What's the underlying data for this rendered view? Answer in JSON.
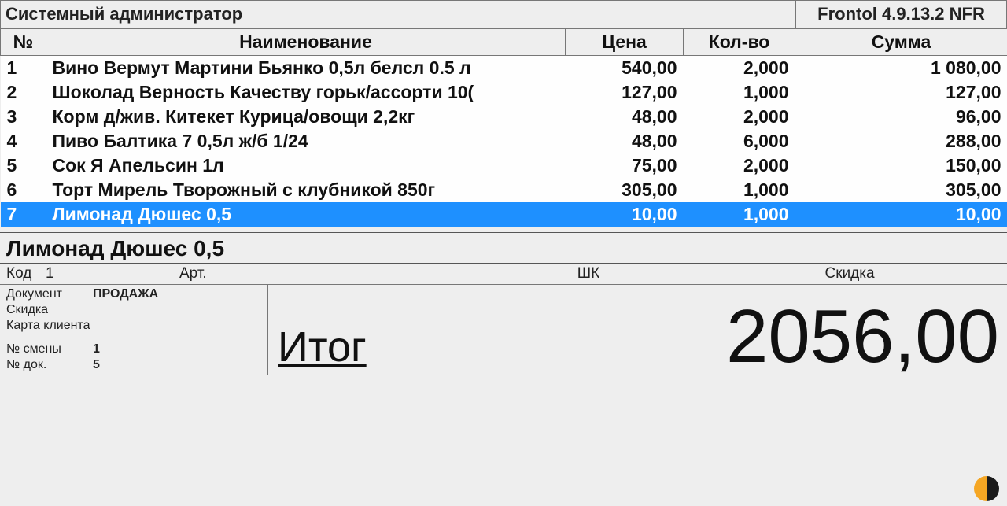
{
  "header": {
    "user_role": "Системный администратор",
    "app_version": "Frontol 4.9.13.2 NFR"
  },
  "table": {
    "columns": {
      "num": "№",
      "name": "Наименование",
      "price": "Цена",
      "qty": "Кол-во",
      "sum": "Сумма"
    },
    "rows": [
      {
        "num": "1",
        "name": "Вино Вермут Мартини Бьянко 0,5л белсл 0.5 л",
        "price": "540,00",
        "qty": "2,000",
        "sum": "1 080,00",
        "selected": false
      },
      {
        "num": "2",
        "name": "Шоколад Верность Качеству горьк/ассорти 10(",
        "price": "127,00",
        "qty": "1,000",
        "sum": "127,00",
        "selected": false
      },
      {
        "num": "3",
        "name": "Корм д/жив. Китекет Курица/овощи 2,2кг",
        "price": "48,00",
        "qty": "2,000",
        "sum": "96,00",
        "selected": false
      },
      {
        "num": "4",
        "name": "Пиво Балтика 7 0,5л ж/б 1/24",
        "price": "48,00",
        "qty": "6,000",
        "sum": "288,00",
        "selected": false
      },
      {
        "num": "5",
        "name": "Сок Я Апельсин 1л",
        "price": "75,00",
        "qty": "2,000",
        "sum": "150,00",
        "selected": false
      },
      {
        "num": "6",
        "name": "Торт Мирель Творожный с клубникой 850г",
        "price": "305,00",
        "qty": "1,000",
        "sum": "305,00",
        "selected": false
      },
      {
        "num": "7",
        "name": "Лимонад Дюшес 0,5",
        "price": "10,00",
        "qty": "1,000",
        "sum": "10,00",
        "selected": true
      }
    ]
  },
  "detail": {
    "title": "Лимонад Дюшес 0,5",
    "code_label": "Код",
    "code_value": "1",
    "art_label": "Арт.",
    "art_value": "",
    "barcode_label": "ШК",
    "barcode_value": "",
    "discount_label": "Скидка",
    "discount_value": ""
  },
  "meta": {
    "doc_label": "Документ",
    "doc_value": "ПРОДАЖА",
    "discount_label": "Скидка",
    "discount_value": "",
    "card_label": "Карта клиента",
    "card_value": "",
    "shift_label": "№ смены",
    "shift_value": "1",
    "docnum_label": "№ док.",
    "docnum_value": "5"
  },
  "total": {
    "label": "Итог",
    "value": "2056,00"
  }
}
